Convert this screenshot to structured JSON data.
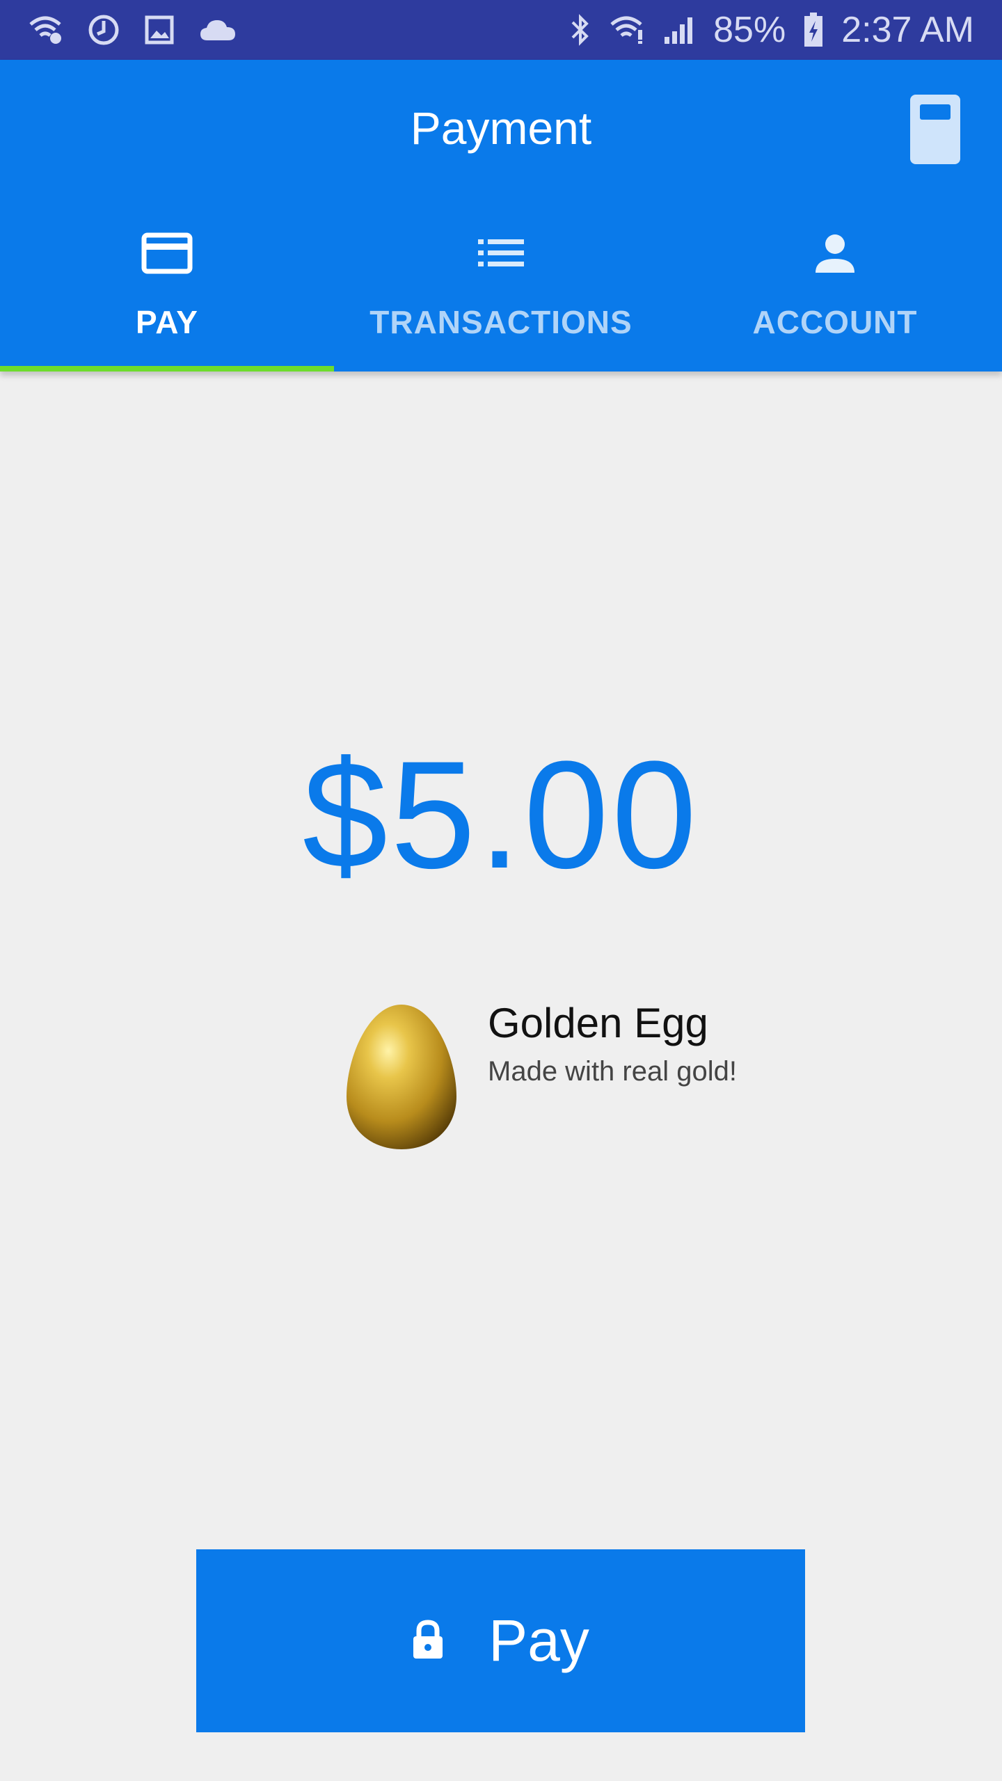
{
  "status_bar": {
    "left_icons": [
      "wifi-question-icon",
      "sync-icon",
      "image-icon",
      "cloud-icon"
    ],
    "right_icons": [
      "bluetooth-icon",
      "wifi-alert-icon",
      "signal-icon",
      "battery-charging-icon"
    ],
    "battery": "85%",
    "time": "2:37 AM"
  },
  "app_bar": {
    "title": "Payment",
    "action_icon": "calculator-icon",
    "tabs": [
      {
        "label": "PAY",
        "icon": "credit-card-icon",
        "active": true
      },
      {
        "label": "TRANSACTIONS",
        "icon": "list-icon",
        "active": false
      },
      {
        "label": "ACCOUNT",
        "icon": "person-icon",
        "active": false
      }
    ]
  },
  "payment": {
    "amount": "$5.00",
    "product": {
      "name": "Golden Egg",
      "description": "Made with real gold!",
      "image": "golden-egg-image"
    },
    "pay_button": {
      "label": "Pay",
      "icon": "lock-icon"
    }
  },
  "colors": {
    "status_bar": "#2e3b9e",
    "primary": "#0a7aea",
    "tab_indicator": "#6edc2c",
    "background": "#efefef"
  }
}
